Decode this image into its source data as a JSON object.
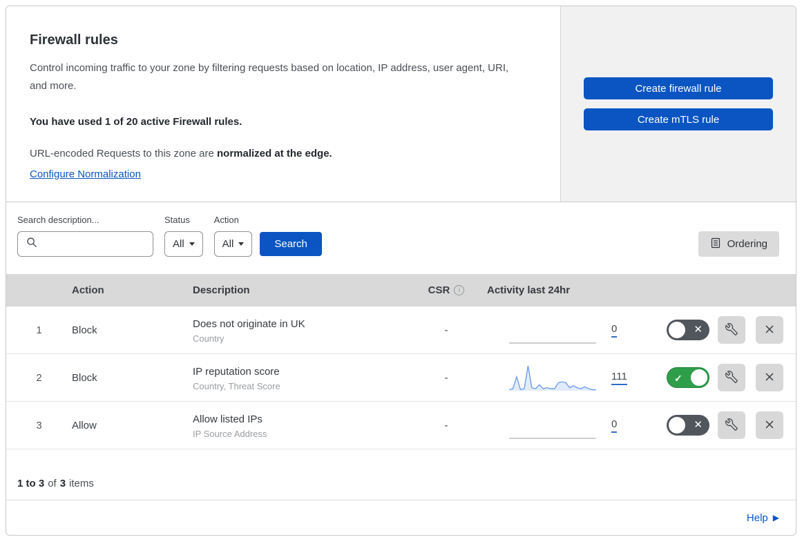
{
  "page": {
    "title": "Firewall rules",
    "description": "Control incoming traffic to your zone by filtering requests based on location, IP address, user agent, URI, and more.",
    "usage_notice": "You have used 1 of 20 active Firewall rules.",
    "normalization_prefix": "URL-encoded Requests to this zone are ",
    "normalization_bold": "normalized at the edge.",
    "normalization_link": "Configure Normalization"
  },
  "actions_panel": {
    "create_firewall_rule": "Create firewall rule",
    "create_mtls_rule": "Create mTLS rule"
  },
  "filters": {
    "search_label": "Search description...",
    "search_value": "",
    "status_label": "Status",
    "status_value": "All",
    "action_label": "Action",
    "action_value": "All",
    "search_button": "Search",
    "ordering_button": "Ordering"
  },
  "table": {
    "headers": {
      "action": "Action",
      "description": "Description",
      "csr": "CSR",
      "activity": "Activity last 24hr"
    },
    "rows": [
      {
        "priority": "1",
        "action": "Block",
        "description": "Does not originate in UK",
        "match_fields": "Country",
        "csr": "-",
        "activity_count": "0",
        "enabled": false,
        "sparkline": []
      },
      {
        "priority": "2",
        "action": "Block",
        "description": "IP reputation score",
        "match_fields": "Country, Threat Score",
        "csr": "-",
        "activity_count": "111",
        "enabled": true,
        "sparkline": [
          1,
          2,
          14,
          1,
          2,
          25,
          3,
          2,
          6,
          2,
          3,
          2,
          2,
          8,
          9,
          8,
          3,
          5,
          3,
          2,
          4,
          2,
          1,
          1
        ]
      },
      {
        "priority": "3",
        "action": "Allow",
        "description": "Allow listed IPs",
        "match_fields": "IP Source Address",
        "csr": "-",
        "activity_count": "0",
        "enabled": false,
        "sparkline": []
      }
    ]
  },
  "chart_data": {
    "type": "area",
    "title": "Activity last 24hr (rule 2: IP reputation score)",
    "x": [
      0,
      1,
      2,
      3,
      4,
      5,
      6,
      7,
      8,
      9,
      10,
      11,
      12,
      13,
      14,
      15,
      16,
      17,
      18,
      19,
      20,
      21,
      22,
      23
    ],
    "values": [
      1,
      2,
      14,
      1,
      2,
      25,
      3,
      2,
      6,
      2,
      3,
      2,
      2,
      8,
      9,
      8,
      3,
      5,
      3,
      2,
      4,
      2,
      1,
      1
    ],
    "total": 111,
    "xlabel": "",
    "ylabel": "",
    "ylim": [
      0,
      25
    ],
    "grid": false,
    "legend": false
  },
  "footer": {
    "range_bold": "1 to 3",
    "of_text": "of",
    "total_bold": "3",
    "items_text": "items"
  },
  "help": {
    "label": "Help"
  },
  "icons": {
    "search": "magnifier-icon",
    "dropdown": "caret-down-icon",
    "ordering": "list-document-icon",
    "csr_info": "info-circle-icon",
    "toggle_off": "x-mark",
    "toggle_on": "check-mark",
    "edit": "wrench-icon",
    "delete": "x-icon",
    "help": "caret-right-icon"
  },
  "colors": {
    "accent_blue": "#0a55c2",
    "toggle_on_green": "#2f9e4b",
    "toggle_off_gray": "#51565c",
    "table_header_bg": "#d9d9d9",
    "panel_bg": "#f1f1f2",
    "spark_stroke": "#6f9fe8",
    "spark_fill": "#e2ebf9"
  }
}
